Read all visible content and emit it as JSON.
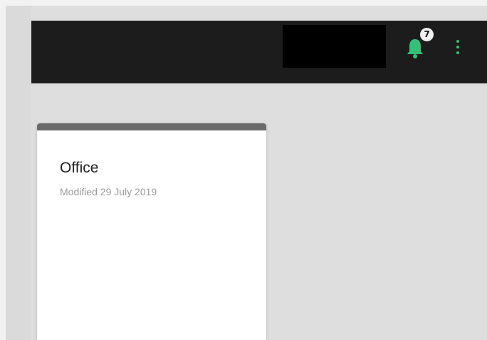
{
  "header": {
    "notifications": {
      "icon": "bell-icon",
      "count": "7",
      "accent_color": "#35c07a"
    },
    "menu_icon": "more-vertical-icon"
  },
  "cards": [
    {
      "title": "Office",
      "subtitle": "Modified 29 July 2019"
    }
  ]
}
